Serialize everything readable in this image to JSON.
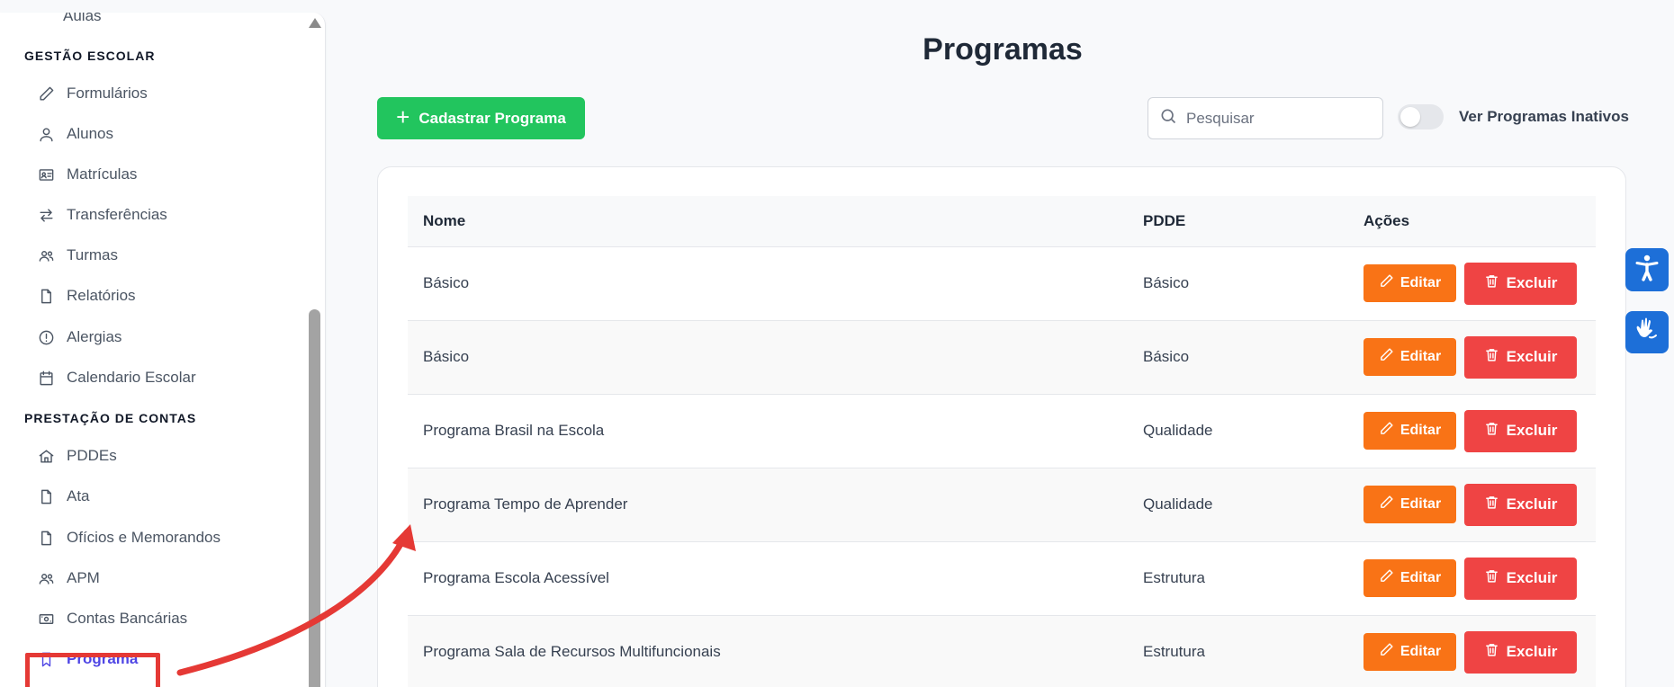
{
  "sidebar": {
    "top_item": "Aulas",
    "sections": [
      {
        "title": "GESTÃO ESCOLAR",
        "items": [
          {
            "label": "Formulários",
            "icon": "pencil-icon"
          },
          {
            "label": "Alunos",
            "icon": "user-icon"
          },
          {
            "label": "Matrículas",
            "icon": "id-card-icon"
          },
          {
            "label": "Transferências",
            "icon": "transfer-arrows-icon"
          },
          {
            "label": "Turmas",
            "icon": "users-icon"
          },
          {
            "label": "Relatórios",
            "icon": "file-icon"
          },
          {
            "label": "Alergias",
            "icon": "alert-circle-icon"
          },
          {
            "label": "Calendario Escolar",
            "icon": "calendar-icon"
          }
        ]
      },
      {
        "title": "PRESTAÇÃO DE CONTAS",
        "items": [
          {
            "label": "PDDEs",
            "icon": "home-icon"
          },
          {
            "label": "Ata",
            "icon": "file-icon"
          },
          {
            "label": "Ofícios e Memorandos",
            "icon": "file-icon"
          },
          {
            "label": "APM",
            "icon": "users-icon"
          },
          {
            "label": "Contas Bancárias",
            "icon": "banknote-icon"
          },
          {
            "label": "Programa",
            "icon": "bookmark-icon",
            "active": true
          }
        ]
      }
    ]
  },
  "main": {
    "title": "Programas",
    "create_button": "Cadastrar Programa",
    "search_placeholder": "Pesquisar",
    "toggle_label": "Ver Programas Inativos",
    "toggle_on": false,
    "table": {
      "headers": [
        "Nome",
        "PDDE",
        "Ações"
      ],
      "rows": [
        {
          "nome": "Básico",
          "pdde": "Básico"
        },
        {
          "nome": "Básico",
          "pdde": "Básico"
        },
        {
          "nome": "Programa Brasil na Escola",
          "pdde": "Qualidade"
        },
        {
          "nome": "Programa Tempo de Aprender",
          "pdde": "Qualidade"
        },
        {
          "nome": "Programa Escola Acessível",
          "pdde": "Estrutura"
        },
        {
          "nome": "Programa Sala de Recursos Multifuncionais",
          "pdde": "Estrutura"
        }
      ],
      "edit_label": "Editar",
      "delete_label": "Excluir"
    }
  },
  "widgets": {
    "accessibility": "accessibility-person-icon",
    "sign_language": "sign-language-hands-icon"
  },
  "colors": {
    "green": "#22c55e",
    "orange": "#f97316",
    "red": "#ef4444",
    "active": "#4f46e5",
    "annotation": "#e53935",
    "widget_blue": "#1d6fd8"
  }
}
